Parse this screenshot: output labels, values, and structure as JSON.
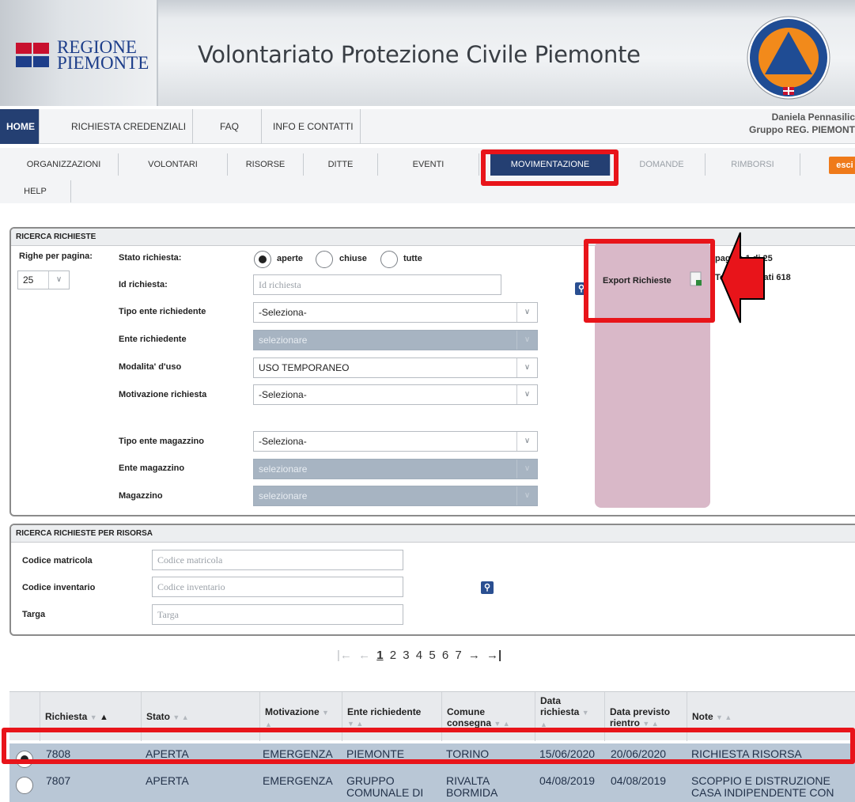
{
  "header": {
    "logo_line1": "REGIONE",
    "logo_line2": "PIEMONTE",
    "title": "Volontariato Protezione Civile Piemonte",
    "emblem_label": "protezione-civile-emblem"
  },
  "nav_primary": {
    "items": [
      "HOME",
      "RICHIESTA CREDENZIALI",
      "FAQ",
      "INFO E CONTATTI"
    ],
    "user_name": "Daniela Pennasilic",
    "user_group": "Gruppo REG. PIEMONT"
  },
  "nav_secondary": {
    "items": [
      "ORGANIZZAZIONI",
      "VOLONTARI",
      "RISORSE",
      "DITTE",
      "EVENTI",
      "MOVIMENTAZIONE",
      "DOMANDE",
      "RIMBORSI"
    ],
    "active": "MOVIMENTAZIONE",
    "esci_label": "esci",
    "help_label": "HELP"
  },
  "search_panel": {
    "title": "RICERCA RICHIESTE",
    "rows_label": "Righe per pagina:",
    "rows_value": "25",
    "stato_label": "Stato richiesta:",
    "stato_options": [
      "aperte",
      "chiuse",
      "tutte"
    ],
    "stato_selected": "aperte",
    "id_label": "Id richiesta:",
    "id_placeholder": "Id richiesta",
    "tipo_ente_label": "Tipo ente richiedente",
    "tipo_ente_value": "-Seleziona-",
    "ente_label": "Ente richiedente",
    "ente_value": "selezionare",
    "modalita_label": "Modalita' d'uso",
    "modalita_value": "USO TEMPORANEO",
    "motivazione_label": "Motivazione richiesta",
    "motivazione_value": "-Seleziona-",
    "tipo_magazzino_label": "Tipo ente magazzino",
    "tipo_magazzino_value": "-Seleziona-",
    "ente_magazzino_label": "Ente magazzino",
    "ente_magazzino_value": "selezionare",
    "magazzino_label": "Magazzino",
    "magazzino_value": "selezionare",
    "export_label": "Export Richieste",
    "page_info": "pagina 1 di 25",
    "total_info": "Totale risultati 618"
  },
  "resource_panel": {
    "title": "RICERCA RICHIESTE PER RISORSA",
    "matricola_label": "Codice matricola",
    "matricola_placeholder": "Codice matricola",
    "inventario_label": "Codice inventario",
    "inventario_placeholder": "Codice inventario",
    "targa_label": "Targa",
    "targa_placeholder": "Targa"
  },
  "pagination": {
    "first": "|←",
    "prev": "←",
    "pages": [
      "1",
      "2",
      "3",
      "4",
      "5",
      "6",
      "7"
    ],
    "current": "1",
    "next": "→",
    "last": "→|"
  },
  "table": {
    "columns": [
      "Richiesta",
      "Stato",
      "Motivazione",
      "Ente richiedente",
      "Comune consegna",
      "Data richiesta",
      "Data previsto rientro",
      "Note"
    ],
    "rows": [
      {
        "id": "7808",
        "stato": "APERTA",
        "motivazione": "EMERGENZA",
        "ente": "PIEMONTE",
        "comune": "TORINO",
        "data": "15/06/2020",
        "rientro": "20/06/2020",
        "note": "RICHIESTA RISORSA",
        "selected": true
      },
      {
        "id": "7807",
        "stato": "APERTA",
        "motivazione": "EMERGENZA",
        "ente": "GRUPPO COMUNALE DI",
        "comune": "RIVALTA BORMIDA",
        "data": "04/08/2019",
        "rientro": "04/08/2019",
        "note": "SCOPPIO E DISTRUZIONE CASA INDIPENDENTE CON",
        "selected": false
      }
    ]
  },
  "colors": {
    "nav_active": "#243f72",
    "annotation_red": "#e8141a",
    "export_panel": "#d9b8c8",
    "row_highlight": "#b9c7d6",
    "esci": "#ef7a1a"
  }
}
